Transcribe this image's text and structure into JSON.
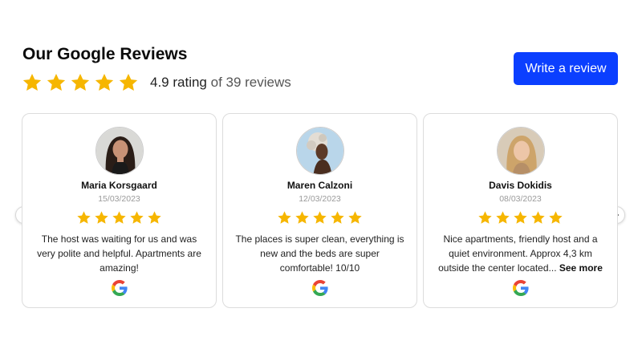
{
  "header": {
    "title": "Our Google Reviews",
    "rating_value": "4.9 rating",
    "rating_suffix": " of 39 reviews",
    "stars": 5,
    "write_button_label": "Write a review"
  },
  "colors": {
    "accent": "#0b3fff",
    "star": "#f6b600"
  },
  "reviews": [
    {
      "name": "Maria Korsgaard",
      "date": "15/03/2023",
      "stars": 5,
      "text": "The host was waiting for us and was very polite and helpful. Apartments are amazing!",
      "more": ""
    },
    {
      "name": "Maren Calzoni",
      "date": "12/03/2023",
      "stars": 5,
      "text": "The places is super clean, everything is new and the beds are super comfortable! 10/10",
      "more": ""
    },
    {
      "name": "Davis Dokidis",
      "date": "08/03/2023",
      "stars": 5,
      "text": "Nice apartments, friendly host and a quiet environment. Approx 4,3 km outside the center located...",
      "more": "See more"
    }
  ],
  "icons": {
    "star": "star-icon",
    "google": "google-logo-icon",
    "prev": "chevron-left-icon",
    "next": "chevron-right-icon"
  }
}
